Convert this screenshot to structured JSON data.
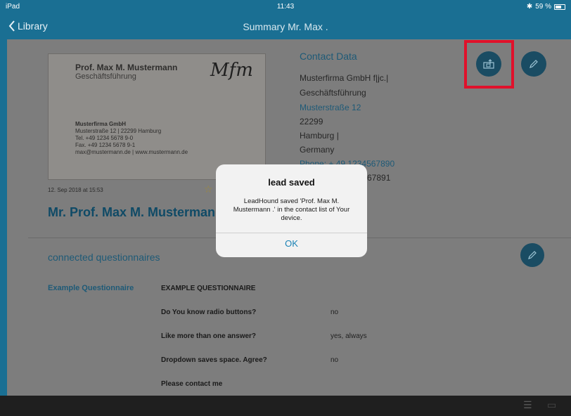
{
  "statusbar": {
    "device": "iPad",
    "time": "11:43",
    "battery": "59 %"
  },
  "nav": {
    "back_label": "Library",
    "title": "Summary Mr. Max ."
  },
  "card": {
    "name": "Prof. Max M. Mustermann",
    "role": "Geschäftsführung",
    "logo": "Mfm",
    "company": "Musterfirma GmbH",
    "address": "Musterstraße 12 | 22299 Hamburg",
    "tel": "Tel. +49 1234 5678 9-0",
    "fax": "Fax. +49 1234 5678 9-1",
    "web": "max@mustermann.de | www.mustermann.de"
  },
  "scan_date": "12. Sep 2018 at 15:53",
  "full_name": "Mr. Prof. Max M. Musterman",
  "contact": {
    "heading": "Contact Data",
    "company": "Musterfirma GmbH f|jc.|",
    "role": "Geschäftsführung",
    "street": "Musterstraße 12",
    "zip": "22299",
    "city": "Hamburg |",
    "country": "Germany",
    "phone": "Phone: + 49 1234567890",
    "phone2_partial": "67891"
  },
  "questionnaires": {
    "title": "connected questionnaires",
    "name": "Example Questionnaire",
    "header": "EXAMPLE QUESTIONNAIRE",
    "rows": [
      {
        "q": "Do You know radio buttons?",
        "a": "no"
      },
      {
        "q": "Like more than one answer?",
        "a": "yes, always"
      },
      {
        "q": "Dropdown saves space. Agree?",
        "a": "no"
      },
      {
        "q": "Please contact me",
        "a": ""
      }
    ]
  },
  "dialog": {
    "title": "lead saved",
    "message": "LeadHound saved 'Prof. Max M. Mustermann .' in the contact list of Your device.",
    "ok": "OK"
  },
  "icons": {
    "share": "share-icon",
    "edit": "pencil-icon",
    "star": "star-icon",
    "tab_list": "list-icon",
    "tab_card": "card-icon"
  },
  "colors": {
    "nav": "#1a6f93",
    "accent": "#1a82b5",
    "highlight": "#e0112b"
  }
}
